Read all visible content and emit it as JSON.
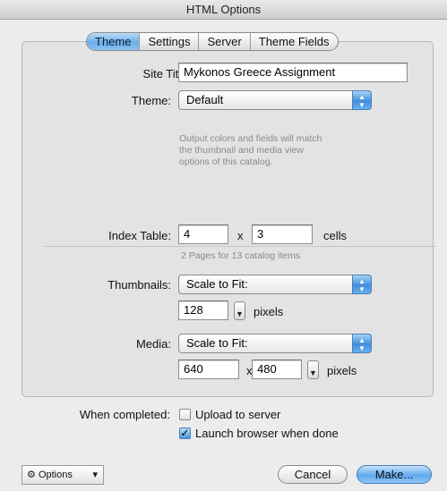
{
  "window": {
    "title": "HTML Options"
  },
  "tabs": [
    {
      "label": "Theme",
      "active": true
    },
    {
      "label": "Settings",
      "active": false
    },
    {
      "label": "Server",
      "active": false
    },
    {
      "label": "Theme Fields",
      "active": false
    }
  ],
  "site_title": {
    "label": "Site Title:",
    "value": "Mykonos Greece Assignment"
  },
  "theme": {
    "label": "Theme:",
    "selected": "Default",
    "note": [
      "Output colors and fields will match",
      "the thumbnail and media view",
      "options of this catalog."
    ]
  },
  "index_table": {
    "label": "Index Table:",
    "columns": "4",
    "separator": "x",
    "rows": "3",
    "unit": "cells",
    "note": "2 Pages for 13 catalog items"
  },
  "thumbnails": {
    "label": "Thumbnails:",
    "selected": "Scale to Fit:",
    "size": "128",
    "unit": "pixels"
  },
  "media": {
    "label": "Media:",
    "selected": "Scale to Fit:",
    "width": "640",
    "separator": "x",
    "height": "480",
    "unit": "pixels"
  },
  "when_completed": {
    "label": "When completed:",
    "upload": {
      "label": "Upload to server",
      "checked": false
    },
    "launch": {
      "label": "Launch browser when done",
      "checked": true
    }
  },
  "footer": {
    "options_label": "Options",
    "cancel_label": "Cancel",
    "make_label": "Make..."
  },
  "colors": {
    "accent": "#5ea6ee",
    "window_bg": "#ececec"
  },
  "icons": {
    "options": "gear-icon",
    "popup": "up-down-arrows-icon",
    "checkmark": "checkmark-icon"
  }
}
